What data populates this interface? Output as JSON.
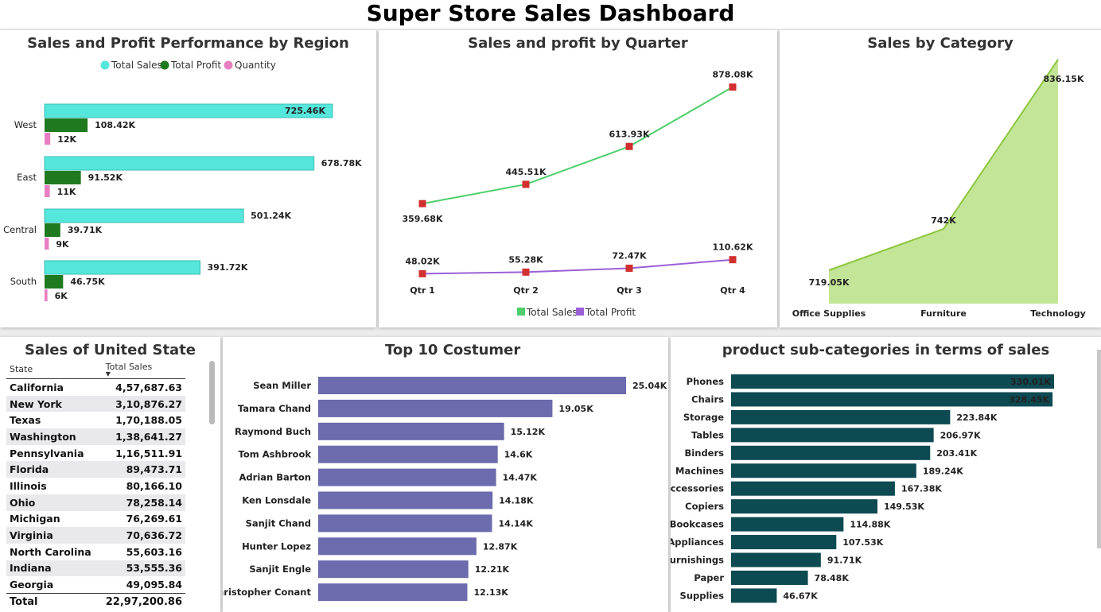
{
  "dashboard_title": "Super Store Sales Dashboard",
  "colors": {
    "sales_cyan": "#55e6dc",
    "profit_green": "#1f7a1f",
    "qty_pink": "#e87fc0",
    "line_green": "#4ccf6a",
    "line_purple": "#9b5fd6",
    "marker_red": "#d13030",
    "area_green": "#c3e597",
    "area_stroke": "#8cc63f",
    "customer_bar": "#6b6bad",
    "subcat_bar": "#0d4a52"
  },
  "region_panel": {
    "title": "Sales and Profit Performance by Region",
    "legend": [
      "Total Sales",
      "Total Profit",
      "Quantity"
    ],
    "chart_data": {
      "type": "bar",
      "categories": [
        "West",
        "East",
        "Central",
        "South"
      ],
      "series": [
        {
          "name": "Total Sales",
          "values": [
            725.46,
            678.78,
            501.24,
            391.72
          ],
          "labels": [
            "725.46K",
            "678.78K",
            "501.24K",
            "391.72K"
          ]
        },
        {
          "name": "Total Profit",
          "values": [
            108.42,
            91.52,
            39.71,
            46.75
          ],
          "labels": [
            "108.42K",
            "91.52K",
            "39.71K",
            "46.75K"
          ]
        },
        {
          "name": "Quantity",
          "values": [
            12,
            11,
            9,
            6
          ],
          "labels": [
            "12K",
            "11K",
            "9K",
            "6K"
          ]
        }
      ]
    }
  },
  "quarter_panel": {
    "title": "Sales and profit by Quarter",
    "legend": [
      "Total Sales",
      "Total Profit"
    ],
    "chart_data": {
      "type": "line",
      "categories": [
        "Qtr 1",
        "Qtr 2",
        "Qtr 3",
        "Qtr 4"
      ],
      "series": [
        {
          "name": "Total Sales",
          "values": [
            359.68,
            445.51,
            613.93,
            878.08
          ],
          "labels": [
            "359.68K",
            "445.51K",
            "613.93K",
            "878.08K"
          ]
        },
        {
          "name": "Total Profit",
          "values": [
            48.02,
            55.28,
            72.47,
            110.62
          ],
          "labels": [
            "48.02K",
            "55.28K",
            "72.47K",
            "110.62K"
          ]
        }
      ]
    }
  },
  "category_panel": {
    "title": "Sales by Category",
    "chart_data": {
      "type": "area",
      "categories": [
        "Office Supplies",
        "Furniture",
        "Technology"
      ],
      "values": [
        719.05,
        742,
        836.15
      ],
      "labels": [
        "719.05K",
        "742K",
        "836.15K"
      ]
    }
  },
  "state_panel": {
    "title": "Sales of United State",
    "columns": [
      "State",
      "Total Sales"
    ],
    "rows": [
      [
        "California",
        "4,57,687.63"
      ],
      [
        "New York",
        "3,10,876.27"
      ],
      [
        "Texas",
        "1,70,188.05"
      ],
      [
        "Washington",
        "1,38,641.27"
      ],
      [
        "Pennsylvania",
        "1,16,511.91"
      ],
      [
        "Florida",
        "89,473.71"
      ],
      [
        "Illinois",
        "80,166.10"
      ],
      [
        "Ohio",
        "78,258.14"
      ],
      [
        "Michigan",
        "76,269.61"
      ],
      [
        "Virginia",
        "70,636.72"
      ],
      [
        "North Carolina",
        "55,603.16"
      ],
      [
        "Indiana",
        "53,555.36"
      ],
      [
        "Georgia",
        "49,095.84"
      ]
    ],
    "total": [
      "Total",
      "22,97,200.86"
    ]
  },
  "customer_panel": {
    "title": "Top 10 Costumer",
    "chart_data": {
      "type": "bar",
      "categories": [
        "Sean Miller",
        "Tamara Chand",
        "Raymond Buch",
        "Tom Ashbrook",
        "Adrian Barton",
        "Ken Lonsdale",
        "Sanjit Chand",
        "Hunter Lopez",
        "Sanjit Engle",
        "Christopher Conant"
      ],
      "values": [
        25.04,
        19.05,
        15.12,
        14.6,
        14.47,
        14.18,
        14.14,
        12.87,
        12.21,
        12.13
      ],
      "labels": [
        "25.04K",
        "19.05K",
        "15.12K",
        "14.6K",
        "14.47K",
        "14.18K",
        "14.14K",
        "12.87K",
        "12.21K",
        "12.13K"
      ]
    }
  },
  "subcat_panel": {
    "title": "product sub-categories in terms of sales",
    "chart_data": {
      "type": "bar",
      "categories": [
        "Phones",
        "Chairs",
        "Storage",
        "Tables",
        "Binders",
        "Machines",
        "Accessories",
        "Copiers",
        "Bookcases",
        "Appliances",
        "Furnishings",
        "Paper",
        "Supplies"
      ],
      "values": [
        330.01,
        328.45,
        223.84,
        206.97,
        203.41,
        189.24,
        167.38,
        149.53,
        114.88,
        107.53,
        91.71,
        78.48,
        46.67
      ],
      "labels": [
        "330.01K",
        "328.45K",
        "223.84K",
        "206.97K",
        "203.41K",
        "189.24K",
        "167.38K",
        "149.53K",
        "114.88K",
        "107.53K",
        "91.71K",
        "78.48K",
        "46.67K"
      ]
    }
  }
}
